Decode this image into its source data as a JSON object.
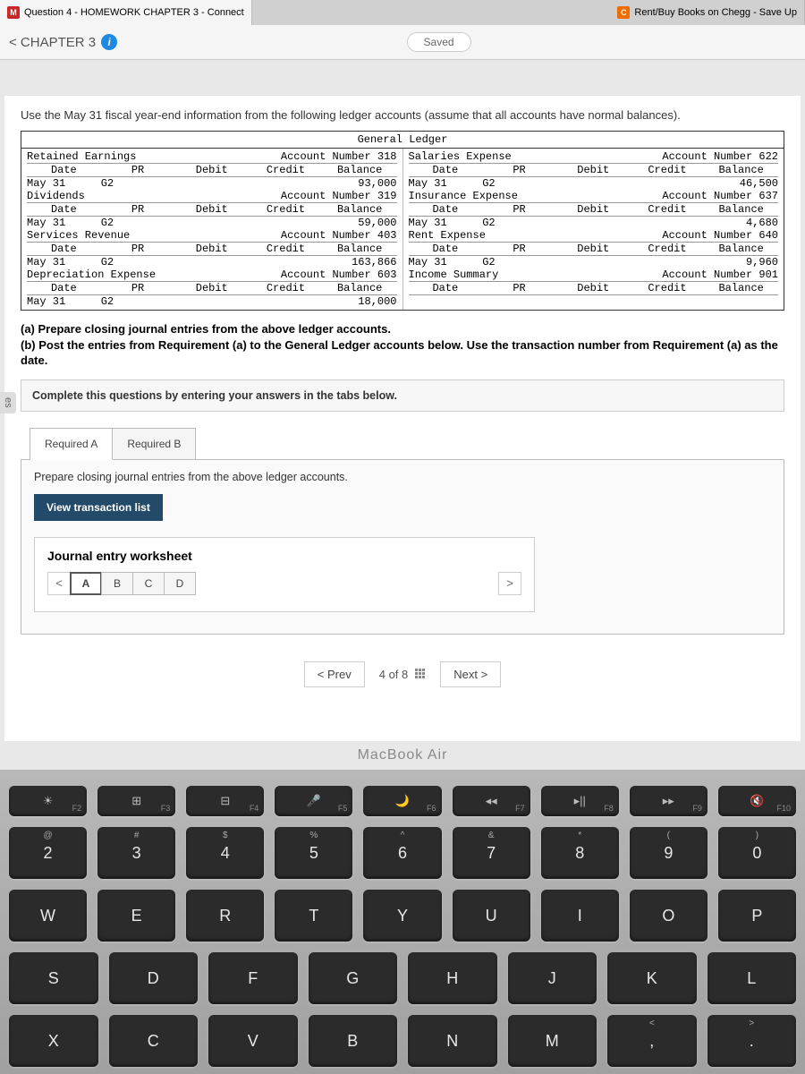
{
  "tabs": [
    {
      "icon": "M",
      "label": "Question 4 - HOMEWORK CHAPTER 3 - Connect"
    },
    {
      "icon": "C",
      "label": "Rent/Buy Books on Chegg - Save Up"
    }
  ],
  "header": {
    "title": "< CHAPTER 3",
    "saved": "Saved"
  },
  "left_stub": "es",
  "intro": "Use the May 31 fiscal year-end information from the following ledger accounts (assume that all accounts have normal balances).",
  "ledger": {
    "title": "General Ledger",
    "col1": [
      {
        "name": "Retained Earnings",
        "num": "Account Number 318",
        "row": [
          "May 31",
          "G2",
          "",
          "93,000"
        ]
      },
      {
        "name": "Dividends",
        "num": "Account Number 319",
        "row": [
          "May 31",
          "G2",
          "",
          "59,000"
        ]
      },
      {
        "name": "Services Revenue",
        "num": "Account Number 403",
        "row": [
          "May 31",
          "G2",
          "",
          "163,866"
        ]
      },
      {
        "name": "Depreciation Expense",
        "num": "Account Number 603",
        "row": [
          "May 31",
          "G2",
          "",
          "18,000"
        ]
      }
    ],
    "col2": [
      {
        "name": "Salaries Expense",
        "num": "Account Number 622",
        "row": [
          "May 31",
          "G2",
          "",
          "46,500"
        ]
      },
      {
        "name": "Insurance Expense",
        "num": "Account Number 637",
        "row": [
          "May 31",
          "G2",
          "",
          "4,680"
        ]
      },
      {
        "name": "Rent Expense",
        "num": "Account Number 640",
        "row": [
          "May 31",
          "G2",
          "",
          "9,960"
        ]
      },
      {
        "name": "Income Summary",
        "num": "Account Number 901",
        "row": [
          "",
          "",
          "",
          ""
        ]
      }
    ],
    "cols": [
      "Date",
      "PR",
      "Debit",
      "Credit",
      "Balance"
    ]
  },
  "instructions": {
    "a": "(a) Prepare closing journal entries from the above ledger accounts.",
    "b": "(b) Post the entries from Requirement (a) to the General Ledger accounts below. Use the transaction number from Requirement (a) as the date."
  },
  "complete_band": "Complete this questions by entering your answers in the tabs below.",
  "req_tabs": [
    "Required A",
    "Required B"
  ],
  "panel_text": "Prepare closing journal entries from the above ledger accounts.",
  "view_btn": "View transaction list",
  "worksheet": {
    "title": "Journal entry worksheet",
    "tabs": [
      "A",
      "B",
      "C",
      "D"
    ]
  },
  "pager": {
    "prev": "< Prev",
    "info": "4 of 8",
    "next": "Next  >"
  },
  "macbook": "MacBook Air",
  "keyboard": {
    "fn": [
      "F2",
      "F3",
      "F4",
      "F5",
      "F6",
      "F7",
      "F8",
      "F9",
      "F10"
    ],
    "fn_icons": [
      "☀",
      "⊞",
      "⊟",
      "🎤",
      "🌙",
      "◂◂",
      "▸||",
      "▸▸",
      "🔇"
    ],
    "r1_top": [
      "@",
      "#",
      "$",
      "%",
      "^",
      "&",
      "*",
      "(",
      ")"
    ],
    "r1": [
      "2",
      "3",
      "4",
      "5",
      "6",
      "7",
      "8",
      "9",
      "0"
    ],
    "r2": [
      "W",
      "E",
      "R",
      "T",
      "Y",
      "U",
      "I",
      "O",
      "P"
    ],
    "r3": [
      "S",
      "D",
      "F",
      "G",
      "H",
      "J",
      "K",
      "L"
    ],
    "r4": [
      "X",
      "C",
      "V",
      "B",
      "N",
      "M",
      "<",
      ">"
    ]
  }
}
